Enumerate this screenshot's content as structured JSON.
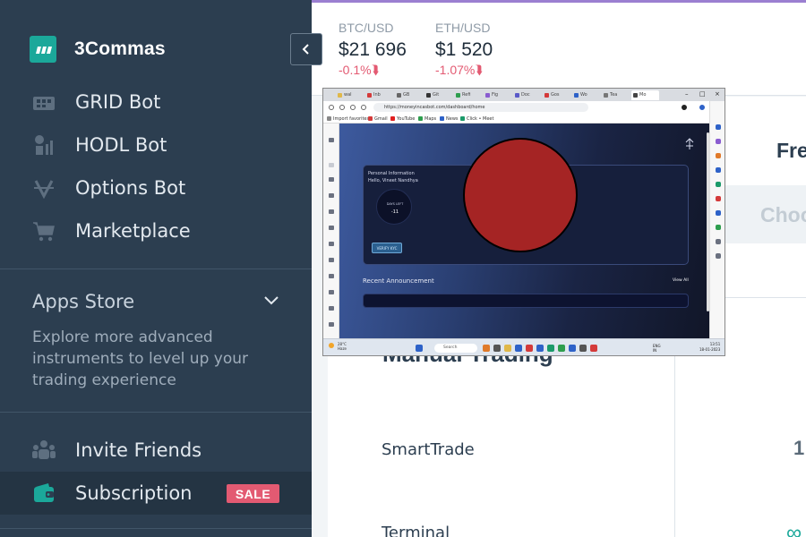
{
  "app": {
    "name": "3Commas"
  },
  "sidebar": {
    "nav": [
      {
        "label": "GRID Bot",
        "icon": "grid-bot-icon"
      },
      {
        "label": "HODL Bot",
        "icon": "hodl-bot-icon"
      },
      {
        "label": "Options Bot",
        "icon": "options-bot-icon"
      },
      {
        "label": "Marketplace",
        "icon": "cart-icon"
      }
    ],
    "apps_store": {
      "title": "Apps Store",
      "description": "Explore more advanced instruments to level up your trading experience"
    },
    "bottom_nav": [
      {
        "label": "Invite Friends",
        "icon": "users-icon"
      },
      {
        "label": "Subscription",
        "icon": "wallet-icon",
        "badge": "SALE"
      }
    ]
  },
  "tickers": [
    {
      "pair": "BTC/USD",
      "price": "$21 696",
      "change": "-0.1%",
      "direction": "down"
    },
    {
      "pair": "ETH/USD",
      "price": "$1 520",
      "change": "-1.07%",
      "direction": "down"
    }
  ],
  "main": {
    "section_title": "Manual Trading",
    "tools": [
      "SmartTrade",
      "Terminal"
    ],
    "right_header": "Fre",
    "right_select": "Choo",
    "right_value": "1",
    "right_symbol": "∞"
  },
  "embedded_screenshot": {
    "url": "https://moneyincasbot.com/dashboard/home",
    "bookmarks": [
      "Import favorites",
      "Gmail",
      "YouTube",
      "Maps",
      "News",
      "Click • Meet"
    ],
    "card": {
      "title": "Personal Information",
      "greeting": "Hello, Vineet Nandhya",
      "days_label": "DAYS LEFT",
      "days_value": "-11",
      "button": "VERIFY KYC"
    },
    "announcement_title": "Recent Announcement",
    "view_all": "View All",
    "taskbar": {
      "weather": "28°C",
      "weather_desc": "Haze",
      "search": "Search",
      "lang": "ENG",
      "region": "IN",
      "time": "13:51",
      "date": "18-01-2023"
    }
  },
  "colors": {
    "sidebar_bg": "#2c3e50",
    "brand_teal": "#1ba89a",
    "negative": "#e35a72",
    "sale_badge": "#e35a72",
    "redaction": "#a52424"
  }
}
